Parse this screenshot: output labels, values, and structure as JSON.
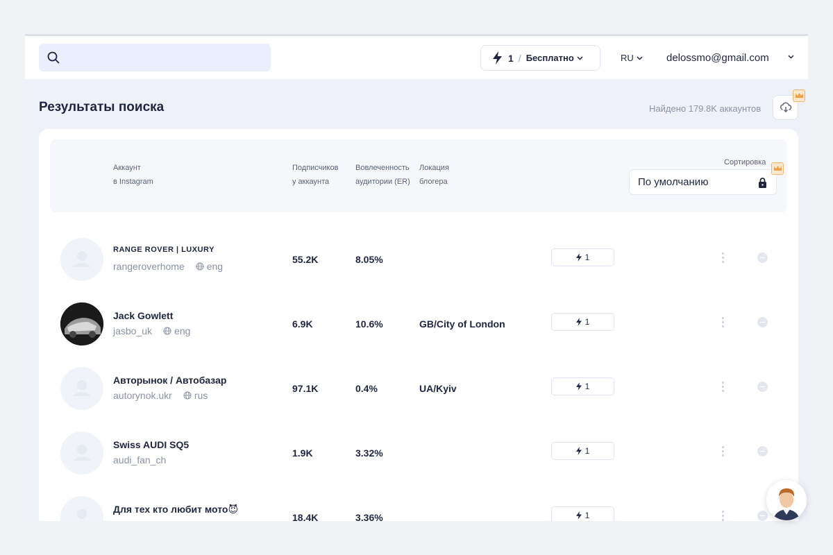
{
  "topbar": {
    "search_placeholder": "",
    "plan": {
      "count": "1",
      "separator": "/",
      "label": "Бесплатно"
    },
    "language": "RU",
    "email": "delossmo@gmail.com"
  },
  "header": {
    "title": "Результаты поиска",
    "found": "Найдено 179.8K аккаунтов"
  },
  "table": {
    "columns": {
      "account_line1": "Аккаунт",
      "account_line2": "в Instagram",
      "followers_line1": "Подписчиков",
      "followers_line2": "у аккаунта",
      "er_line1": "Вовлеченность",
      "er_line2": "аудитории (ER)",
      "location_line1": "Локация",
      "location_line2": "блогера"
    },
    "sort_label": "Сортировка",
    "sort_value": "По умолчанию",
    "rows": [
      {
        "name": "RANGE ROVER | LUXURY",
        "handle": "rangeroverhome",
        "lang": "eng",
        "followers": "55.2K",
        "er": "8.05%",
        "location": "",
        "pill": "1"
      },
      {
        "name": "Jack Gowlett",
        "handle": "jasbo_uk",
        "lang": "eng",
        "followers": "6.9K",
        "er": "10.6%",
        "location": "GB/City of London",
        "pill": "1"
      },
      {
        "name": "Авторынок / Автобазар",
        "handle": "autorynok.ukr",
        "lang": "rus",
        "followers": "97.1K",
        "er": "0.4%",
        "location": "UA/Kyiv",
        "pill": "1"
      },
      {
        "name": "Swiss AUDI SQ5",
        "handle": "audi_fan_ch",
        "lang": "",
        "followers": "1.9K",
        "er": "3.32%",
        "location": "",
        "pill": "1"
      },
      {
        "name": "Для тех кто любит мото😈",
        "handle": "",
        "lang": "",
        "followers": "18.4K",
        "er": "3.36%",
        "location": "",
        "pill": "1"
      }
    ]
  },
  "colors": {
    "accent": "#1f2540",
    "muted": "#8a91a5",
    "premium": "#f0b46b"
  }
}
